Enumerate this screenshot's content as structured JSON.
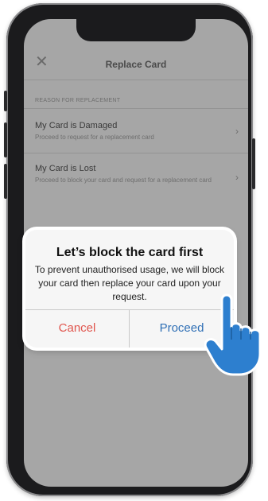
{
  "header": {
    "title": "Replace Card",
    "close_icon": "close-icon"
  },
  "section": {
    "label": "REASON FOR REPLACEMENT"
  },
  "options": [
    {
      "title": "My Card is Damaged",
      "subtitle": "Proceed to request for a replacement card"
    },
    {
      "title": "My Card is Lost",
      "subtitle": "Proceed to block your card and request for a replacement card"
    }
  ],
  "dialog": {
    "title": "Let’s block the card first",
    "message": "To prevent unauthorised usage, we will block your card then replace your card upon your request.",
    "cancel_label": "Cancel",
    "proceed_label": "Proceed"
  },
  "colors": {
    "cancel": "#e0554d",
    "proceed": "#2f6fb5",
    "hand": "#2d7fcf",
    "overlay": "#a6a6a6"
  },
  "icons": {
    "pointer": "pointing-hand-icon",
    "chevron": "chevron-right-icon"
  }
}
